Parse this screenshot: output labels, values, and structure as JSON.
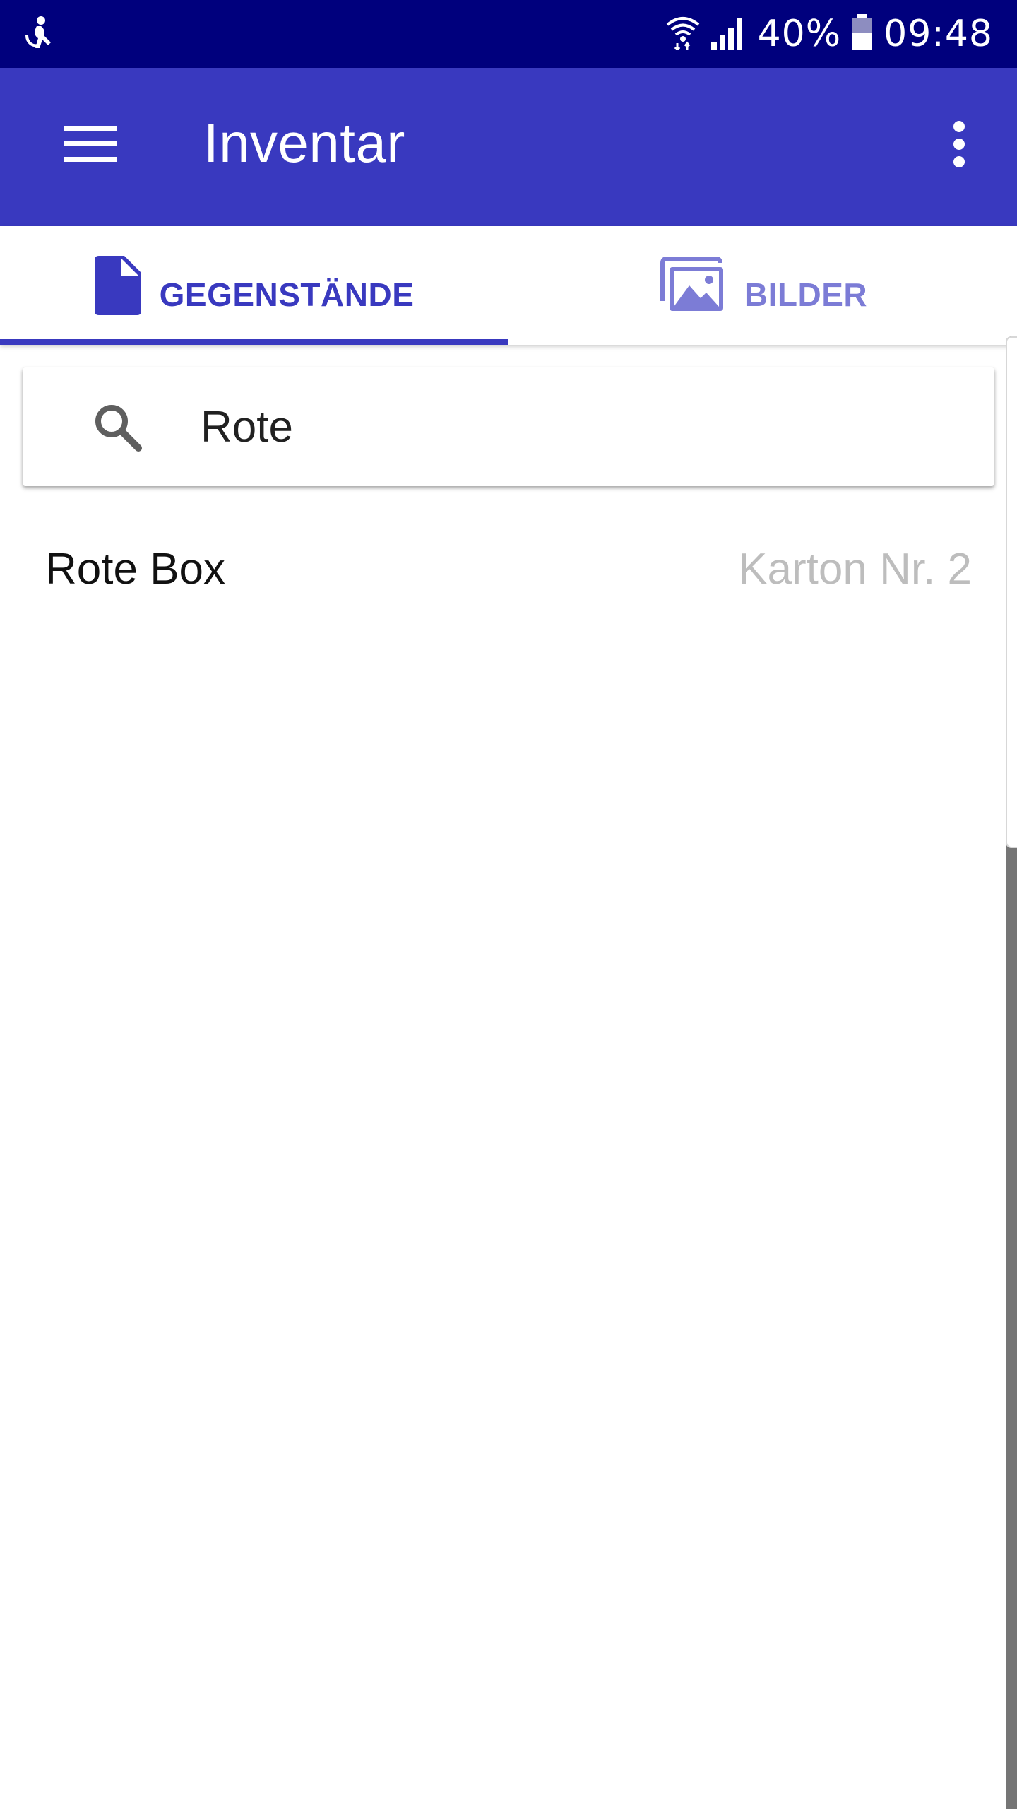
{
  "status_bar": {
    "battery_percent": "40%",
    "time": "09:48",
    "icons": [
      "accessibility-icon",
      "wifi-icon",
      "signal-icon",
      "battery-icon"
    ]
  },
  "app_bar": {
    "title": "Inventar",
    "icons": [
      "menu-icon",
      "more-vert-icon"
    ]
  },
  "tabs": [
    {
      "label": "GEGENSTÄNDE",
      "icon": "document-icon",
      "selected": true
    },
    {
      "label": "BILDER",
      "icon": "images-icon",
      "selected": false
    }
  ],
  "search": {
    "value": "Rote",
    "icon": "search-icon"
  },
  "results": [
    {
      "name": "Rote Box",
      "location": "Karton Nr. 2"
    }
  ],
  "colors": {
    "status_bar": "#00007d",
    "primary": "#3939bf",
    "tab_inactive": "#7c7cd6",
    "secondary_text": "#bdbdbd"
  }
}
